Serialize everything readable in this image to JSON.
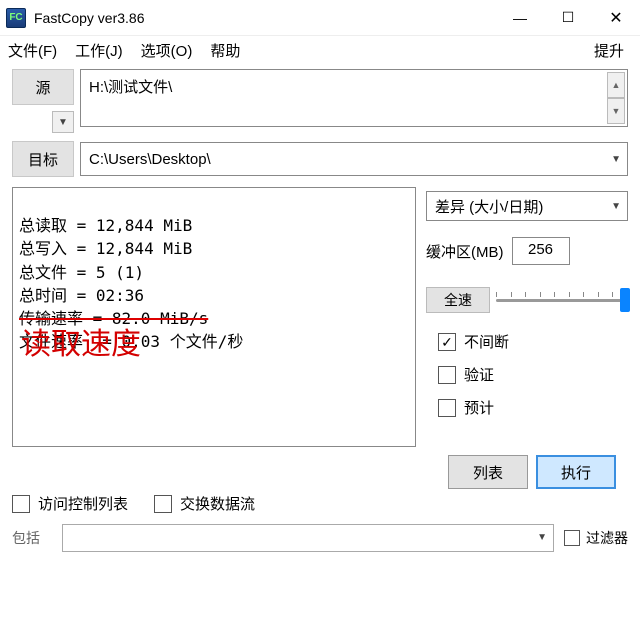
{
  "titlebar": {
    "app_icon_text": "FC",
    "title": "FastCopy ver3.86"
  },
  "menu": {
    "file": "文件(F)",
    "work": "工作(J)",
    "options": "选项(O)",
    "help": "帮助",
    "lift": "提升"
  },
  "buttons": {
    "source": "源",
    "dest": "目标",
    "list": "列表",
    "execute": "执行",
    "full_speed": "全速"
  },
  "paths": {
    "source": "H:\\测试文件\\",
    "dest": "C:\\Users\\Desktop\\"
  },
  "log": {
    "l1": "总读取 = 12,844 MiB",
    "l2": "总写入 = 12,844 MiB",
    "l3": "总文件 = 5 (1)",
    "l4": "总时间 = 02:36",
    "l5": "传输速率 = 82.0 MiB/s",
    "l6": "文件速率  = 0.03 个文件/秒"
  },
  "annotation": "读取速度",
  "controls": {
    "mode": "差异 (大小/日期)",
    "buffer_label": "缓冲区(MB)",
    "buffer_value": "256"
  },
  "checks": {
    "nonstop": "不间断",
    "verify": "验证",
    "estimate": "预计",
    "acl": "访问控制列表",
    "altstream": "交换数据流",
    "filter": "过滤器"
  },
  "labels": {
    "include": "包括"
  }
}
